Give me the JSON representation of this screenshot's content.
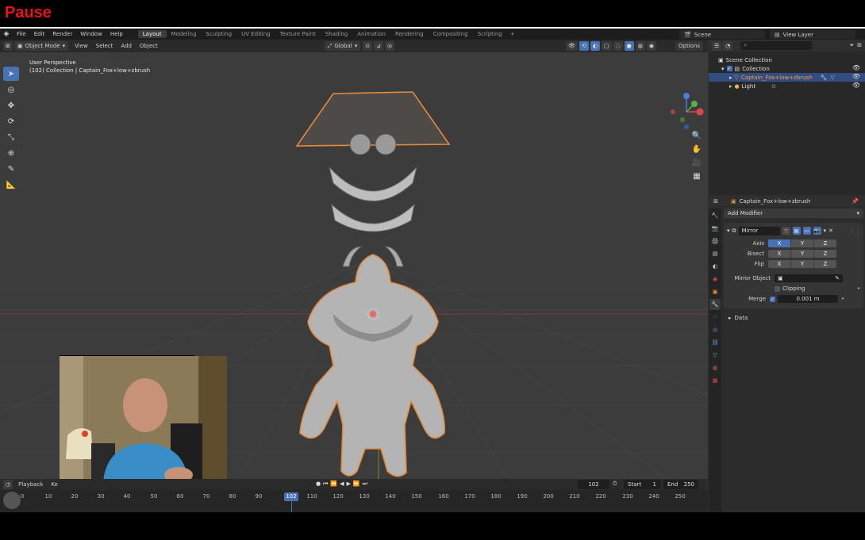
{
  "banner": {
    "title": "Pause"
  },
  "menubar": {
    "items": [
      "File",
      "Edit",
      "Render",
      "Window",
      "Help"
    ],
    "workspaces": [
      "Layout",
      "Modeling",
      "Sculpting",
      "UV Editing",
      "Texture Paint",
      "Shading",
      "Animation",
      "Rendering",
      "Compositing",
      "Scripting"
    ],
    "active_workspace": "Layout",
    "add_tab": "+",
    "scene": "Scene",
    "view_layer": "View Layer"
  },
  "viewport_header": {
    "mode": "Object Mode",
    "menus": [
      "View",
      "Select",
      "Add",
      "Object"
    ],
    "orientation": "Global",
    "options": "Options"
  },
  "viewport": {
    "perspective": "User Perspective",
    "collection_info": "(102) Collection | Captain_Fox+low+zbrush"
  },
  "timeline": {
    "playback": "Playback",
    "keying": "Ke",
    "current_frame": "102",
    "start_label": "Start",
    "start": "1",
    "end_label": "End",
    "end": "250",
    "ticks": [
      "0",
      "10",
      "20",
      "30",
      "40",
      "50",
      "60",
      "70",
      "80",
      "90",
      "110",
      "120",
      "130",
      "140",
      "150",
      "160",
      "170",
      "180",
      "190",
      "200",
      "210",
      "220",
      "230",
      "240",
      "250"
    ],
    "marker_label": "102"
  },
  "outliner": {
    "root": "Scene Collection",
    "collection": "Collection",
    "object": "Captain_Fox+low+zbrush",
    "light": "Light"
  },
  "properties": {
    "object_name": "Captain_Fox+low+zbrush",
    "add_modifier": "Add Modifier",
    "modifier_name": "Mirror",
    "axis_label": "Axis",
    "bisect_label": "Bisect",
    "flip_label": "Flip",
    "axes": [
      "X",
      "Y",
      "Z"
    ],
    "mirror_object_label": "Mirror Object",
    "clipping_label": "Clipping",
    "merge_label": "Merge",
    "merge_value": "0.001 m",
    "data_label": "Data"
  },
  "colors": {
    "accent": "#4772b3",
    "selection_outline": "#e8893a",
    "banner_red": "#e8141c"
  }
}
